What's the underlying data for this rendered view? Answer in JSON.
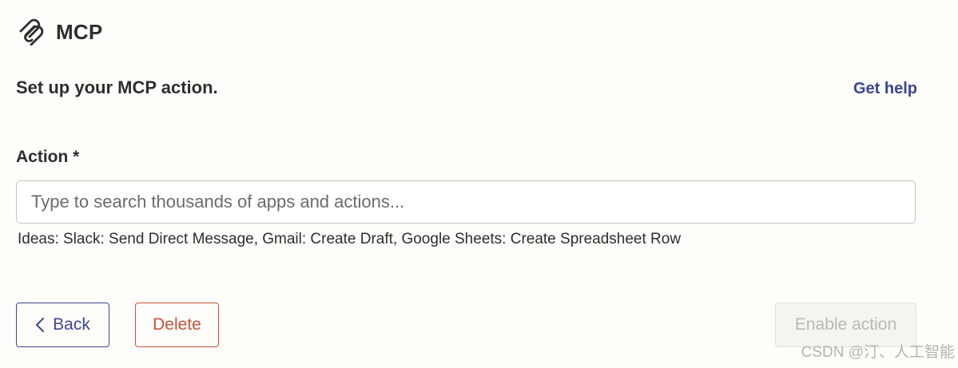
{
  "header": {
    "icon": "mcp-logo-icon",
    "title": "MCP"
  },
  "setup": {
    "subtitle": "Set up your MCP action.",
    "help_link": "Get help"
  },
  "action_field": {
    "label": "Action *",
    "value": "",
    "placeholder": "Type to search thousands of apps and actions...",
    "ideas": "Ideas: Slack: Send Direct Message, Gmail: Create Draft, Google Sheets: Create Spreadsheet Row"
  },
  "buttons": {
    "back_label": "Back",
    "back_icon": "chevron-left-icon",
    "delete_label": "Delete",
    "enable_label": "Enable action"
  },
  "watermark": "CSDN @汀、人工智能",
  "colors": {
    "background": "#fffdf9",
    "text": "#2d2e2e",
    "link": "#3d4592",
    "danger": "#c3553b",
    "disabled_text": "#b9b8b4"
  }
}
